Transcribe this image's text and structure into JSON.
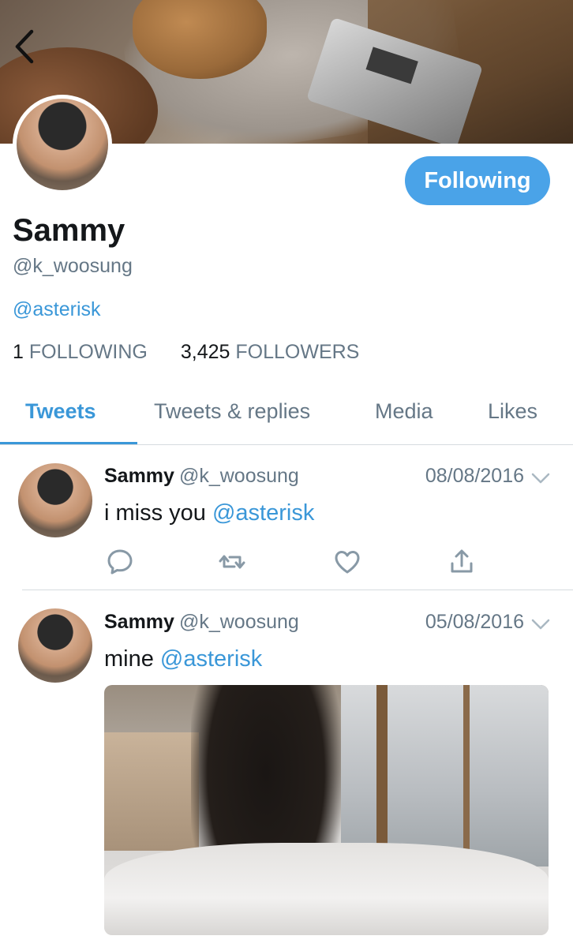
{
  "profile": {
    "name": "Sammy",
    "handle": "@k_woosung",
    "bio_link": "@asterisk",
    "following_count": "1",
    "following_label": "FOLLOWING",
    "followers_count": "3,425",
    "followers_label": "FOLLOWERS",
    "follow_button": "Following"
  },
  "tabs": [
    {
      "label": "Tweets",
      "active": true
    },
    {
      "label": "Tweets & replies",
      "active": false
    },
    {
      "label": "Media",
      "active": false
    },
    {
      "label": "Likes",
      "active": false
    }
  ],
  "tweets": [
    {
      "name": "Sammy",
      "handle": "@k_woosung",
      "date": "08/08/2016",
      "text": "i miss you ",
      "mention": "@asterisk"
    },
    {
      "name": "Sammy",
      "handle": "@k_woosung",
      "date": "05/08/2016",
      "text": "mine ",
      "mention": "@asterisk"
    }
  ],
  "colors": {
    "accent": "#4aa3e8",
    "link": "#3a97d8",
    "secondary_text": "#657786",
    "divider": "#d6dbdf"
  },
  "icons": [
    "back-chevron-icon",
    "reply-icon",
    "retweet-icon",
    "like-heart-icon",
    "share-icon",
    "chevron-down-icon"
  ]
}
